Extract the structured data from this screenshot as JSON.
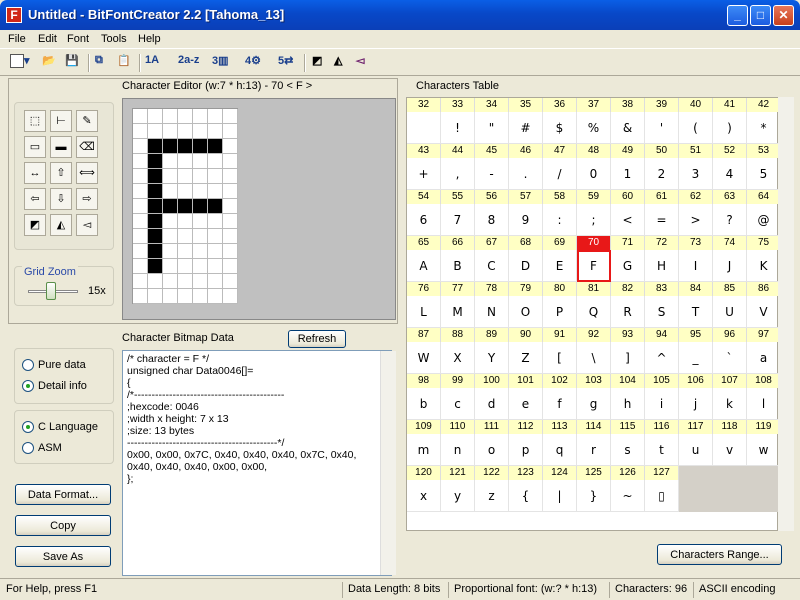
{
  "window": {
    "title": "Untitled - BitFontCreator 2.2 [Tahoma_13]",
    "icon_letter": "F",
    "min": "_",
    "max": "□",
    "close": "✕"
  },
  "menu": [
    "File",
    "Edit",
    "Font",
    "Tools",
    "Help"
  ],
  "toolbar": {
    "az_label": "a-z",
    "n1": "1",
    "n2": "2",
    "n3": "3",
    "n4": "4",
    "n5": "5"
  },
  "editor": {
    "label": "Character Editor (w:7 * h:13) - 70 < F >",
    "grid_cols": 7,
    "grid_rows": 13,
    "on_pixels": [
      [
        2,
        1
      ],
      [
        2,
        2
      ],
      [
        2,
        3
      ],
      [
        2,
        4
      ],
      [
        2,
        5
      ],
      [
        3,
        1
      ],
      [
        4,
        1
      ],
      [
        5,
        1
      ],
      [
        6,
        1
      ],
      [
        7,
        1
      ],
      [
        8,
        1
      ],
      [
        9,
        1
      ],
      [
        10,
        1
      ],
      [
        6,
        2
      ],
      [
        6,
        3
      ],
      [
        6,
        4
      ],
      [
        6,
        5
      ]
    ],
    "zoom_label": "Grid Zoom",
    "zoom_value": "15x"
  },
  "bitmap": {
    "label": "Character Bitmap Data",
    "refresh": "Refresh",
    "code": "/* character = F */\nunsigned char Data0046[]=\n{\n/*-------------------------------------------\n;hexcode: 0046\n;width x height: 7 x 13\n;size: 13 bytes\n-------------------------------------------*/\n0x00, 0x00, 0x7C, 0x40, 0x40, 0x40, 0x7C, 0x40,\n0x40, 0x40, 0x40, 0x00, 0x00,\n};"
  },
  "options": {
    "pure_data": "Pure data",
    "detail_info": "Detail info",
    "c_language": "C Language",
    "asm": "ASM"
  },
  "buttons": {
    "data_format": "Data Format...",
    "copy": "Copy",
    "save_as": "Save As",
    "characters_range": "Characters Range..."
  },
  "chars_table": {
    "label": "Characters Table",
    "selected_code": "70",
    "codes": [
      "32",
      "33",
      "34",
      "35",
      "36",
      "37",
      "38",
      "39",
      "40",
      "41",
      "42",
      "43",
      "44",
      "45",
      "46",
      "47",
      "48",
      "49",
      "50",
      "51",
      "52",
      "53",
      "54",
      "55",
      "56",
      "57",
      "58",
      "59",
      "60",
      "61",
      "62",
      "63",
      "64",
      "65",
      "66",
      "67",
      "68",
      "69",
      "70",
      "71",
      "72",
      "73",
      "74",
      "75",
      "76",
      "77",
      "78",
      "79",
      "80",
      "81",
      "82",
      "83",
      "84",
      "85",
      "86",
      "87",
      "88",
      "89",
      "90",
      "91",
      "92",
      "93",
      "94",
      "95",
      "96",
      "97",
      "98",
      "99",
      "100",
      "101",
      "102",
      "103",
      "104",
      "105",
      "106",
      "107",
      "108",
      "109",
      "110",
      "111",
      "112",
      "113",
      "114",
      "115",
      "116",
      "117",
      "118",
      "119",
      "120",
      "121",
      "122",
      "123",
      "124",
      "125",
      "126",
      "127"
    ],
    "chars": [
      " ",
      "!",
      "\"",
      "#",
      "$",
      "%",
      "&",
      "'",
      "(",
      ")",
      "*",
      "+",
      ",",
      "-",
      ".",
      "/",
      "0",
      "1",
      "2",
      "3",
      "4",
      "5",
      "6",
      "7",
      "8",
      "9",
      ":",
      ";",
      "<",
      "=",
      ">",
      "?",
      "@",
      "A",
      "B",
      "C",
      "D",
      "E",
      "F",
      "G",
      "H",
      "I",
      "J",
      "K",
      "L",
      "M",
      "N",
      "O",
      "P",
      "Q",
      "R",
      "S",
      "T",
      "U",
      "V",
      "W",
      "X",
      "Y",
      "Z",
      "[",
      "\\",
      "]",
      "^",
      "_",
      "`",
      "a",
      "b",
      "c",
      "d",
      "e",
      "f",
      "g",
      "h",
      "i",
      "j",
      "k",
      "l",
      "m",
      "n",
      "o",
      "p",
      "q",
      "r",
      "s",
      "t",
      "u",
      "v",
      "w",
      "x",
      "y",
      "z",
      "{",
      "|",
      "}",
      "~",
      "▯"
    ]
  },
  "status": {
    "help": "For Help, press F1",
    "data_length": "Data Length: 8 bits",
    "proportional": "Proportional font: (w:? * h:13)",
    "characters": "Characters: 96",
    "encoding": "ASCII encoding"
  }
}
